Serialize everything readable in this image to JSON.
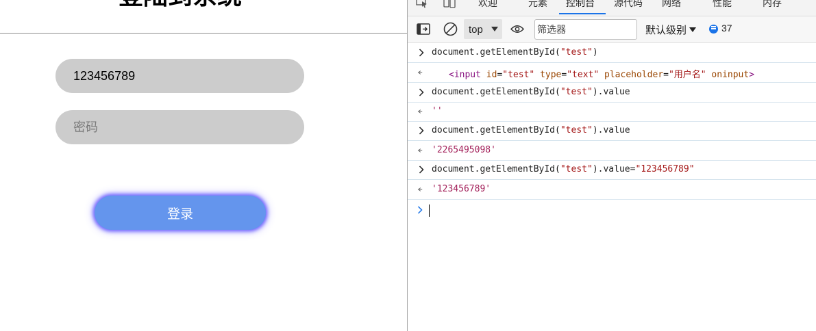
{
  "login": {
    "title": "登陆到系统",
    "username_value": "123456789",
    "username_placeholder": "用户名",
    "password_placeholder": "密码",
    "login_button": "登录"
  },
  "devtools": {
    "tabs": [
      {
        "label": "欢迎"
      },
      {
        "label": "元素"
      },
      {
        "label": "控制台",
        "active": true
      },
      {
        "label": "源代码"
      },
      {
        "label": "网络"
      },
      {
        "label": "性能"
      },
      {
        "label": "内存"
      }
    ],
    "toolbar": {
      "context": "top",
      "filter_placeholder": "筛选器",
      "levels": "默认级别",
      "issues_count": "37"
    },
    "console": {
      "lines": [
        {
          "type": "input",
          "text": "document.getElementById(\"test\")"
        },
        {
          "type": "output",
          "text": "<input id=\"test\" type=\"text\" placeholder=\"用户名\" oninput>"
        },
        {
          "type": "input",
          "text": "document.getElementById(\"test\").value"
        },
        {
          "type": "output",
          "text": "''"
        },
        {
          "type": "input",
          "text": "document.getElementById(\"test\").value"
        },
        {
          "type": "output",
          "text": "'2265495098'"
        },
        {
          "type": "input",
          "text": "document.getElementById(\"test\").value=\"123456789\""
        },
        {
          "type": "output",
          "text": "'123456789'"
        }
      ]
    }
  },
  "colors": {
    "accent": "#1a73e8",
    "login_button": "#6495ed",
    "field_bg": "#cccccc"
  }
}
